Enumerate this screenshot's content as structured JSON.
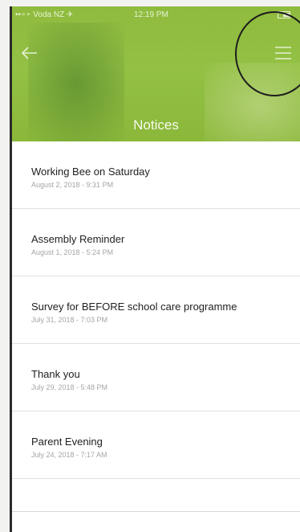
{
  "status_bar": {
    "carrier": "••∘∘ Voda NZ ✈",
    "time": "12:19 PM"
  },
  "header": {
    "title": "Notices"
  },
  "notices": [
    {
      "title": "Working Bee on Saturday",
      "date": "August 2, 2018 - 9:31 PM"
    },
    {
      "title": "Assembly Reminder",
      "date": "August 1, 2018 - 5:24 PM"
    },
    {
      "title": "Survey for BEFORE school care programme",
      "date": "July 31, 2018 - 7:03 PM"
    },
    {
      "title": "Thank you",
      "date": "July 29, 2018 - 5:48 PM"
    },
    {
      "title": "Parent Evening",
      "date": "July 24, 2018 - 7:17 AM"
    }
  ],
  "icons": {
    "back": "back-arrow-icon",
    "menu": "hamburger-menu-icon"
  },
  "colors": {
    "header_green": "#93c144",
    "title_text": "#222222",
    "date_text": "#a5a5a5"
  }
}
